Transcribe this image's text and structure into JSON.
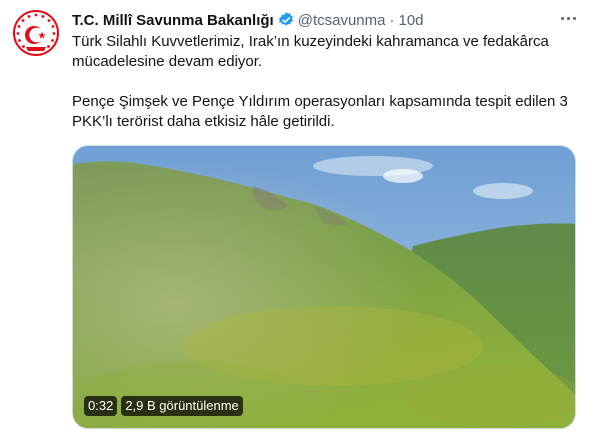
{
  "tweet": {
    "author_name": "T.C. Millî Savunma Bakanlığı",
    "handle": "@tcsavunma",
    "separator": "·",
    "time": "10d",
    "lines": [
      "Türk Silahlı Kuvvetlerimiz, Irak’ın kuzeyindeki kahramanca ve fedakârca",
      "mücadelesine devam ediyor.",
      "Pençe Şimşek ve Pençe Yıldırım operasyonları kapsamında tespit edilen 3",
      "PKK’lı terörist daha etkisiz hâle getirildi."
    ],
    "video": {
      "duration": "0:32",
      "views": "2,9 B görüntülenme"
    }
  },
  "icons": {
    "avatar": "ministry-emblem-icon",
    "verified": "verified-badge-icon",
    "more": "more-options-icon"
  },
  "colors": {
    "verified": "#1d9bf0",
    "emblem_red": "#e30a17",
    "muted_text": "#536471"
  }
}
